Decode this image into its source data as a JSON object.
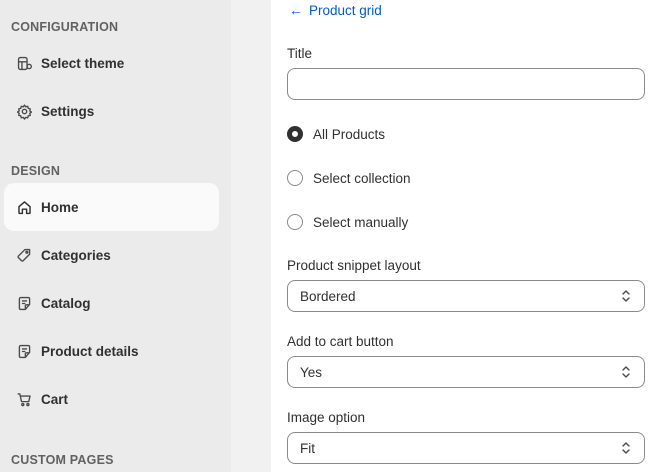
{
  "sidebar": {
    "sections": [
      {
        "title": "CONFIGURATION",
        "items": [
          {
            "label": "Select theme",
            "icon": "theme-icon"
          },
          {
            "label": "Settings",
            "icon": "gear-icon"
          }
        ]
      },
      {
        "title": "DESIGN",
        "items": [
          {
            "label": "Home",
            "icon": "home-icon",
            "active": true
          },
          {
            "label": "Categories",
            "icon": "tag-icon"
          },
          {
            "label": "Catalog",
            "icon": "catalog-icon"
          },
          {
            "label": "Product details",
            "icon": "product-details-icon"
          },
          {
            "label": "Cart",
            "icon": "cart-icon"
          }
        ]
      },
      {
        "title": "CUSTOM PAGES",
        "items": []
      }
    ]
  },
  "panel": {
    "back_label": "Product grid",
    "title_field": {
      "label": "Title",
      "value": "",
      "placeholder": ""
    },
    "source_options": [
      {
        "label": "All Products",
        "checked": true
      },
      {
        "label": "Select collection",
        "checked": false
      },
      {
        "label": "Select manually",
        "checked": false
      }
    ],
    "snippet_layout": {
      "label": "Product snippet layout",
      "value": "Bordered"
    },
    "add_to_cart": {
      "label": "Add to cart button",
      "value": "Yes"
    },
    "image_option": {
      "label": "Image option",
      "value": "Fit"
    }
  },
  "colors": {
    "sidebar_bg": "#ebebeb",
    "active_item_bg": "#fafafa",
    "link": "#005bd3",
    "text": "#303030",
    "muted": "#616161",
    "border": "#8a8a8a"
  }
}
